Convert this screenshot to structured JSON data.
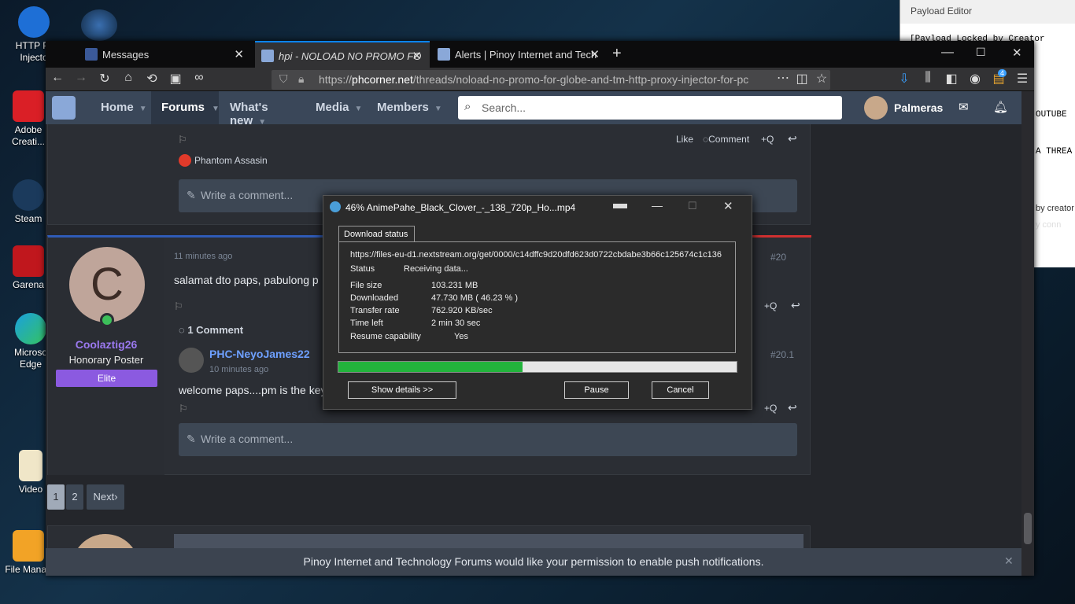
{
  "desktop": {
    "icons": [
      {
        "label": "HTTP Pr Injecto",
        "icon": "http-proxy-injector-icon"
      },
      {
        "label": "Adobe Creati...",
        "icon": "adobe-creative-cloud-icon"
      },
      {
        "label": "Steam",
        "icon": "steam-icon"
      },
      {
        "label": "Garena",
        "icon": "garena-icon"
      },
      {
        "label": "Microso Edge",
        "icon": "edge-icon"
      },
      {
        "label": "Video",
        "icon": "folder-icon"
      },
      {
        "label": "File Manag",
        "icon": "file-manager-icon"
      }
    ]
  },
  "payload_editor": {
    "title": "Payload Editor",
    "lines": [
      "[Payload Locked by Creator",
      "OUTUBE",
      "A THREA"
    ],
    "side_text": [
      "by creator",
      "y conn"
    ]
  },
  "browser": {
    "tabs": [
      {
        "label": "Messages",
        "active": false
      },
      {
        "label": "hpi - NOLOAD NO PROMO FO",
        "active": true
      },
      {
        "label": "Alerts | Pinoy Internet and Tech",
        "active": false
      }
    ],
    "url_prefix": "https://",
    "url_host": "phcorner.net",
    "url_path": "/threads/noload-no-promo-for-globe-and-tm-http-proxy-injector-for-pc",
    "downloads_badge": "4"
  },
  "site": {
    "nav": [
      "Home",
      "Forums",
      "What's new",
      "Media",
      "Members"
    ],
    "search_placeholder": "Search...",
    "username": "Palmeras"
  },
  "post_top": {
    "actions": [
      "Like",
      "Comment",
      "+Q"
    ],
    "reactor": "Phantom Assasin",
    "comment_placeholder": "Write a comment..."
  },
  "post_20": {
    "time": "11 minutes ago",
    "number": "#20",
    "author": "Coolaztig26",
    "author_initial": "C",
    "rank": "Honorary Poster",
    "badge": "Elite",
    "text": "salamat dto paps, pabulong p",
    "comments_header": "1 Comment",
    "reply_author": "PHC-NeyoJames22",
    "reply_time": "10 minutes ago",
    "reply_number": "#20.1",
    "reply_text": "welcome paps....pm is the key",
    "quote_label": "+Q",
    "comment_placeholder": "Write a comment..."
  },
  "pagination": {
    "pages": [
      "1",
      "2"
    ],
    "next": "Next"
  },
  "notification": "Pinoy Internet and Technology Forums would like your permission to enable push notifications.",
  "download_dialog": {
    "title": "46% AnimePahe_Black_Clover_-_138_720p_Ho...mp4",
    "tab": "Download status",
    "url": "https://files-eu-d1.nextstream.org/get/0000/c14dffc9d20dfd623d0722cbdabe3b66c125674c1c136",
    "rows": [
      {
        "label": "Status",
        "value": "Receiving data..."
      },
      {
        "label": "File size",
        "value": "103.231  MB"
      },
      {
        "label": "Downloaded",
        "value": "47.730  MB  ( 46.23 % )"
      },
      {
        "label": "Transfer rate",
        "value": "762.920  KB/sec"
      },
      {
        "label": "Time left",
        "value": "2 min 30 sec"
      },
      {
        "label": "Resume capability",
        "value": "Yes"
      }
    ],
    "progress": 0.4623,
    "buttons": {
      "details": "Show details >>",
      "pause": "Pause",
      "cancel": "Cancel"
    }
  }
}
